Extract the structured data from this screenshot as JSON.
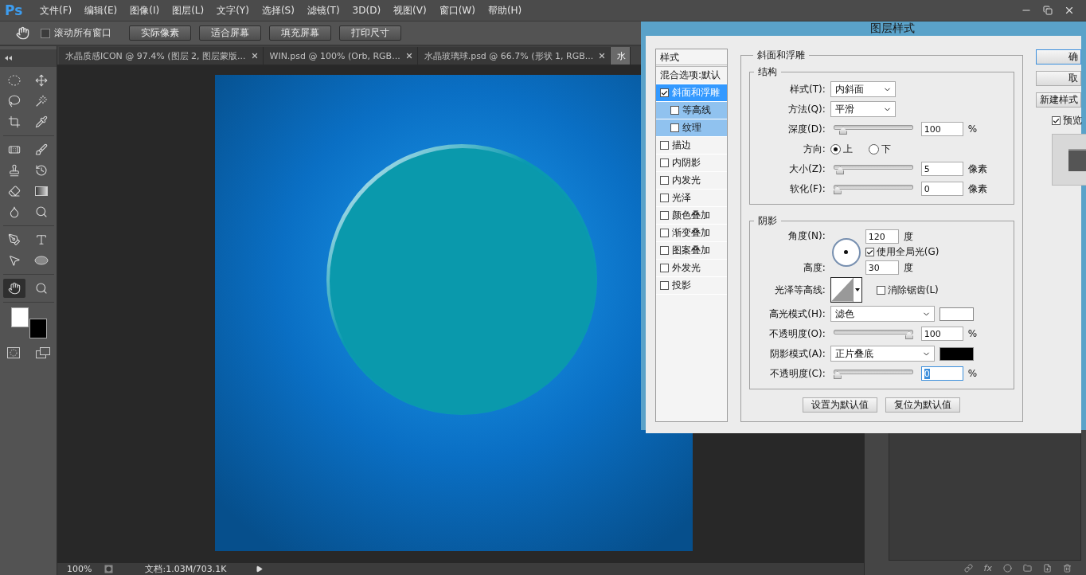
{
  "menubar": {
    "logo": "Ps",
    "menus": [
      "文件(F)",
      "编辑(E)",
      "图像(I)",
      "图层(L)",
      "文字(Y)",
      "选择(S)",
      "滤镜(T)",
      "3D(D)",
      "视图(V)",
      "窗口(W)",
      "帮助(H)"
    ]
  },
  "options_bar": {
    "scroll_all": {
      "label": "滚动所有窗口",
      "checked": false
    },
    "buttons": [
      "实际像素",
      "适合屏幕",
      "填充屏幕",
      "打印尺寸"
    ]
  },
  "document_tabs": [
    {
      "label": "水晶质感ICON @ 97.4% (图层 2, 图层蒙版...",
      "selected": false,
      "closable": true
    },
    {
      "label": "WIN.psd @ 100% (Orb, RGB...",
      "selected": false,
      "closable": true
    },
    {
      "label": "水晶玻璃球.psd @ 66.7% (形状 1, RGB...",
      "selected": false,
      "closable": true
    },
    {
      "label": "水",
      "selected": true,
      "closable": false
    }
  ],
  "tool_groups": [
    {
      "tools": [
        {
          "kind": "marquee",
          "selected": false
        },
        {
          "kind": "move",
          "selected": false
        },
        {
          "kind": "lasso",
          "selected": false
        },
        {
          "kind": "wand",
          "selected": false
        },
        {
          "kind": "crop",
          "selected": false
        },
        {
          "kind": "eyedropper",
          "selected": false
        }
      ]
    },
    {
      "tools": [
        {
          "kind": "healing",
          "selected": false
        },
        {
          "kind": "brush",
          "selected": false
        },
        {
          "kind": "stamp",
          "selected": false
        },
        {
          "kind": "history",
          "selected": false
        },
        {
          "kind": "eraser",
          "selected": false
        },
        {
          "kind": "gradient",
          "selected": false
        },
        {
          "kind": "blur",
          "selected": false
        },
        {
          "kind": "dodge",
          "selected": false
        }
      ]
    },
    {
      "tools": [
        {
          "kind": "pen",
          "selected": false
        },
        {
          "kind": "type",
          "selected": false
        },
        {
          "kind": "path",
          "selected": false
        },
        {
          "kind": "ellipse",
          "selected": false
        }
      ]
    },
    {
      "tools": [
        {
          "kind": "hand",
          "selected": true
        },
        {
          "kind": "zoom",
          "selected": false
        }
      ]
    }
  ],
  "status_bar": {
    "zoom": "100%",
    "doc_info": "文档:1.03M/703.1K"
  },
  "layers_footer": {
    "fx": "fx"
  },
  "dialog": {
    "title": "图层样式",
    "styles_header": "样式",
    "styles": [
      {
        "kind": "header",
        "label": "混合选项:默认",
        "selected": false
      },
      {
        "kind": "check",
        "label": "斜面和浮雕",
        "checked": true,
        "selected": true,
        "children": [
          {
            "kind": "check",
            "label": "等高线",
            "checked": false,
            "selected": false
          },
          {
            "kind": "check",
            "label": "纹理",
            "checked": false,
            "selected": false
          }
        ]
      },
      {
        "kind": "check",
        "label": "描边",
        "checked": false,
        "selected": false
      },
      {
        "kind": "check",
        "label": "内阴影",
        "checked": false,
        "selected": false
      },
      {
        "kind": "check",
        "label": "内发光",
        "checked": false,
        "selected": false
      },
      {
        "kind": "check",
        "label": "光泽",
        "checked": false,
        "selected": false
      },
      {
        "kind": "check",
        "label": "颜色叠加",
        "checked": false,
        "selected": false
      },
      {
        "kind": "check",
        "label": "渐变叠加",
        "checked": false,
        "selected": false
      },
      {
        "kind": "check",
        "label": "图案叠加",
        "checked": false,
        "selected": false
      },
      {
        "kind": "check",
        "label": "外发光",
        "checked": false,
        "selected": false
      },
      {
        "kind": "check",
        "label": "投影",
        "checked": false,
        "selected": false
      }
    ],
    "section_title": "斜面和浮雕",
    "structure": {
      "title": "结构",
      "rows": [
        {
          "kind": "select",
          "label": "样式(T):",
          "value": "内斜面"
        },
        {
          "kind": "select",
          "label": "方法(Q):",
          "value": "平滑"
        },
        {
          "kind": "slider",
          "label": "深度(D):",
          "level": 0.08,
          "value": "100",
          "unit": "%",
          "focused": false
        },
        {
          "kind": "radio",
          "label": "方向:",
          "options": [
            {
              "label": "上",
              "selected": true
            },
            {
              "label": "下",
              "selected": false
            }
          ]
        },
        {
          "kind": "slider",
          "label": "大小(Z):",
          "level": 0.04,
          "value": "5",
          "unit": "像素",
          "focused": false
        },
        {
          "kind": "slider",
          "label": "软化(F):",
          "level": 0,
          "value": "0",
          "unit": "像素",
          "focused": false
        }
      ]
    },
    "shading": {
      "title": "阴影",
      "rows": [
        {
          "kind": "angle",
          "label": "角度(N):",
          "value": "120",
          "unit": "度",
          "global_light": {
            "label": "使用全局光(G)",
            "checked": true
          },
          "altitude": {
            "label": "高度:",
            "value": "30",
            "unit": "度"
          }
        },
        {
          "kind": "contour",
          "label": "光泽等高线:",
          "anti_alias": {
            "label": "消除锯齿(L)",
            "checked": false
          }
        },
        {
          "kind": "select",
          "label": "高光模式(H):",
          "value": "滤色",
          "color": "#ffffff"
        },
        {
          "kind": "slider",
          "label": "不透明度(O):",
          "level": 1,
          "value": "100",
          "unit": "%",
          "focused": false
        },
        {
          "kind": "select",
          "label": "阴影模式(A):",
          "value": "正片叠底",
          "color": "#000000"
        },
        {
          "kind": "slider",
          "label": "不透明度(C):",
          "level": 0,
          "value": "0",
          "unit": "%",
          "focused": true
        }
      ]
    },
    "default_buttons": [
      "设置为默认值",
      "复位为默认值"
    ],
    "side_buttons": [
      "确",
      "取",
      "新建样式"
    ],
    "preview": {
      "label": "预览",
      "checked": true
    }
  }
}
